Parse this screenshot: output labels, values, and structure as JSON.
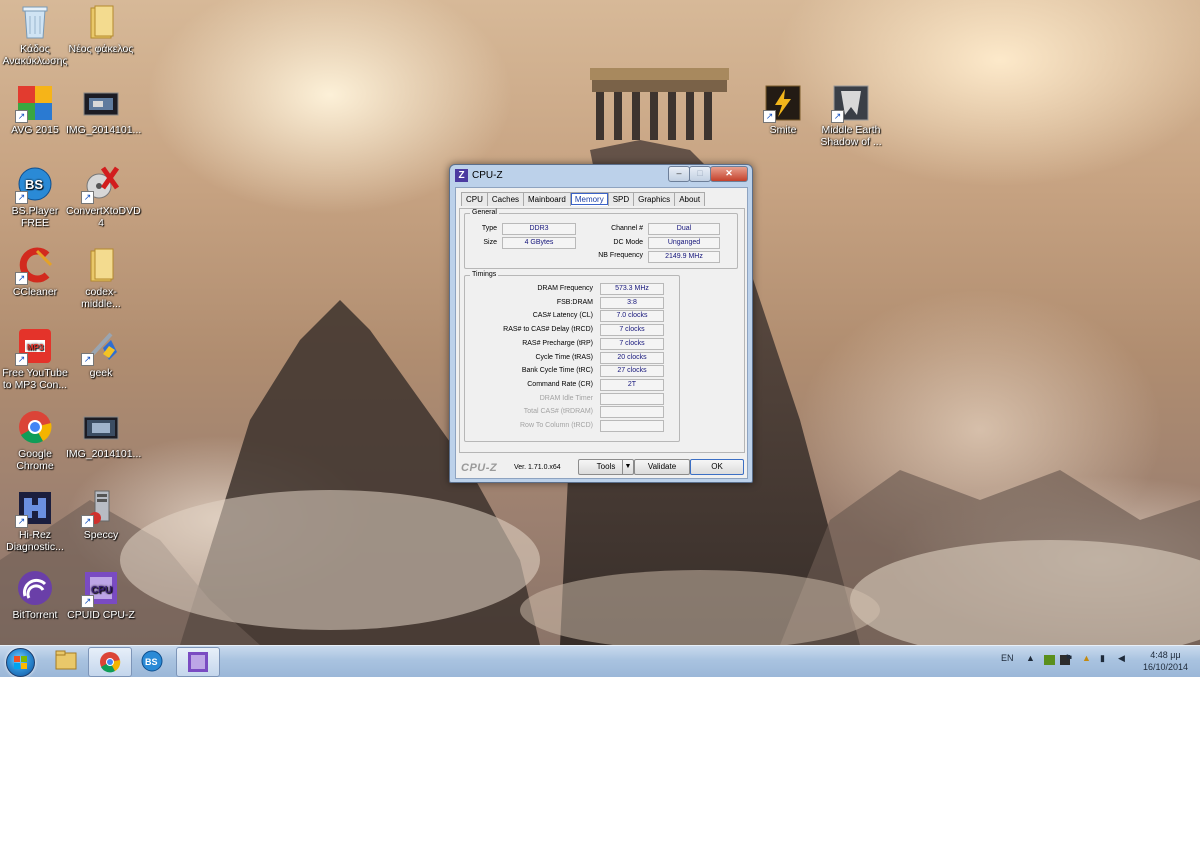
{
  "desktop": {
    "icons": [
      {
        "label": "Κάδος Ανακύκλωσης",
        "icon": "recycle-bin-icon"
      },
      {
        "label": "Νέος φάκελος",
        "icon": "folder-icon"
      },
      {
        "label": "AVG 2015",
        "icon": "avg-icon"
      },
      {
        "label": "IMG_2014101...",
        "icon": "image-file-icon"
      },
      {
        "label": "BS.Player FREE",
        "icon": "bsplayer-icon"
      },
      {
        "label": "ConvertXtoDVD 4",
        "icon": "convertxtodvd-icon"
      },
      {
        "label": "CCleaner",
        "icon": "ccleaner-icon"
      },
      {
        "label": "codex-middle...",
        "icon": "folder-icon"
      },
      {
        "label": "Free YouTube to MP3 Con...",
        "icon": "mp3-icon"
      },
      {
        "label": "geek",
        "icon": "geek-shortcut-icon"
      },
      {
        "label": "Google Chrome",
        "icon": "chrome-icon"
      },
      {
        "label": "IMG_2014101...",
        "icon": "image-file-icon"
      },
      {
        "label": "Hi-Rez Diagnostic...",
        "icon": "hirez-icon"
      },
      {
        "label": "Speccy",
        "icon": "speccy-icon"
      },
      {
        "label": "BitTorrent",
        "icon": "bittorrent-icon"
      },
      {
        "label": "CPUID CPU-Z",
        "icon": "cpuz-icon"
      },
      {
        "label": "Smite",
        "icon": "smite-icon"
      },
      {
        "label": "Middle Earth Shadow of ...",
        "icon": "middle-earth-icon"
      }
    ]
  },
  "cpuz": {
    "title": "CPU-Z",
    "controls": {
      "minimize": "–",
      "maximize": "□",
      "close": "✕"
    },
    "tabs": [
      "CPU",
      "Caches",
      "Mainboard",
      "Memory",
      "SPD",
      "Graphics",
      "About"
    ],
    "active_tab": "Memory",
    "general": {
      "title": "General",
      "type_label": "Type",
      "type_value": "DDR3",
      "size_label": "Size",
      "size_value": "4 GBytes",
      "channel_label": "Channel #",
      "channel_value": "Dual",
      "dcmode_label": "DC Mode",
      "dcmode_value": "Unganged",
      "nbfreq_label": "NB Frequency",
      "nbfreq_value": "2149.9 MHz"
    },
    "timings": {
      "title": "Timings",
      "rows": [
        {
          "label": "DRAM Frequency",
          "value": "573.3 MHz",
          "disabled": false
        },
        {
          "label": "FSB:DRAM",
          "value": "3:8",
          "disabled": false
        },
        {
          "label": "CAS# Latency (CL)",
          "value": "7.0 clocks",
          "disabled": false
        },
        {
          "label": "RAS# to CAS# Delay (tRCD)",
          "value": "7 clocks",
          "disabled": false
        },
        {
          "label": "RAS# Precharge (tRP)",
          "value": "7 clocks",
          "disabled": false
        },
        {
          "label": "Cycle Time (tRAS)",
          "value": "20 clocks",
          "disabled": false
        },
        {
          "label": "Bank Cycle Time (tRC)",
          "value": "27 clocks",
          "disabled": false
        },
        {
          "label": "Command Rate (CR)",
          "value": "2T",
          "disabled": false
        },
        {
          "label": "DRAM Idle Timer",
          "value": "",
          "disabled": true
        },
        {
          "label": "Total CAS# (tRDRAM)",
          "value": "",
          "disabled": true
        },
        {
          "label": "Row To Column (tRCD)",
          "value": "",
          "disabled": true
        }
      ]
    },
    "footer": {
      "brand": "CPU-Z",
      "version": "Ver. 1.71.0.x64",
      "tools": "Tools",
      "validate": "Validate",
      "ok": "OK"
    }
  },
  "taskbar": {
    "language": "EN",
    "time": "4:48 μμ",
    "date": "16/10/2014",
    "pinned": [
      "windows-explorer",
      "google-chrome",
      "bsplayer",
      "cpu-z"
    ]
  }
}
